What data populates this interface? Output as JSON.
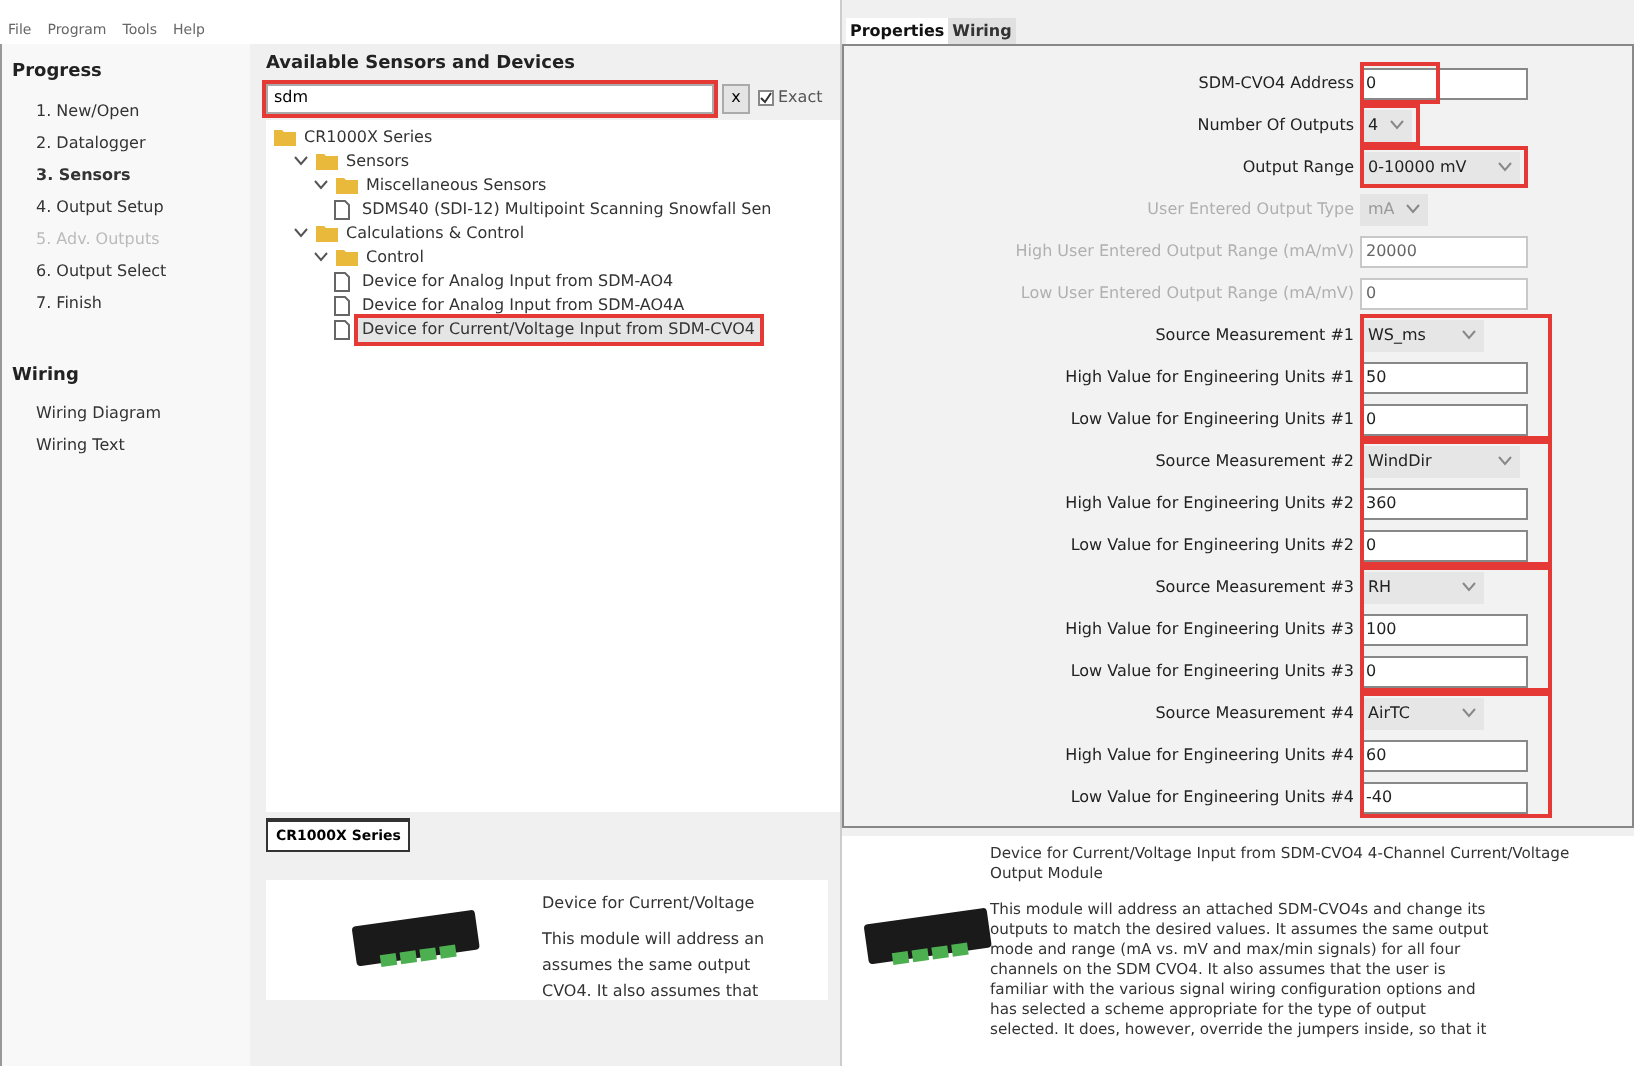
{
  "menu": [
    "File",
    "Program",
    "Tools",
    "Help"
  ],
  "sidebar": {
    "sections": [
      {
        "title": "Progress",
        "items": [
          {
            "label": "1. New/Open",
            "selected": false,
            "disabled": false
          },
          {
            "label": "2. Datalogger",
            "selected": false,
            "disabled": false
          },
          {
            "label": "3. Sensors",
            "selected": true,
            "disabled": false
          },
          {
            "label": "4. Output Setup",
            "selected": false,
            "disabled": false
          },
          {
            "label": "5. Adv. Outputs",
            "selected": false,
            "disabled": true
          },
          {
            "label": "6. Output Select",
            "selected": false,
            "disabled": false
          },
          {
            "label": "7. Finish",
            "selected": false,
            "disabled": false
          }
        ]
      },
      {
        "title": "Wiring",
        "items": [
          {
            "label": "Wiring Diagram",
            "selected": false,
            "disabled": false
          },
          {
            "label": "Wiring Text",
            "selected": false,
            "disabled": false
          }
        ]
      }
    ]
  },
  "sensors": {
    "title": "Available Sensors and Devices",
    "search": {
      "value": "sdm",
      "highlighted": true
    },
    "clear": "x",
    "exact": {
      "label": "Exact",
      "checked": true
    },
    "tree": [
      {
        "kind": "folder",
        "label": "CR1000X Series",
        "children": [
          {
            "kind": "folder",
            "label": "Sensors",
            "expanded": true,
            "children": [
              {
                "kind": "folder",
                "label": "Miscellaneous Sensors",
                "expanded": true,
                "children": [
                  {
                    "kind": "file",
                    "label": "SDMS40 (SDI-12) Multipoint Scanning Snowfall Sen",
                    "selected": false
                  }
                ]
              }
            ]
          },
          {
            "kind": "folder",
            "label": "Calculations & Control",
            "expanded": true,
            "children": [
              {
                "kind": "folder",
                "label": "Control",
                "expanded": true,
                "children": [
                  {
                    "kind": "file",
                    "label": "Device for Analog Input from SDM-AO4",
                    "selected": false
                  },
                  {
                    "kind": "file",
                    "label": "Device for Analog Input from SDM-AO4A",
                    "selected": false
                  },
                  {
                    "kind": "file",
                    "label": "Device for Current/Voltage Input from SDM-CVO4",
                    "selected": true
                  }
                ]
              }
            ]
          }
        ]
      }
    ],
    "tab": "CR1000X Series",
    "description": [
      "Device for Current/Voltage",
      "This module will address an",
      "assumes the same output",
      "CVO4. It also assumes that"
    ]
  },
  "tabs": [
    {
      "label": "Properties",
      "selected": true
    },
    {
      "label": "Wiring",
      "selected": false
    }
  ],
  "groups": [
    {
      "highlighted": true,
      "rows": [
        {
          "kind": "text",
          "label": "SDM-CVO4 Address",
          "value": "0",
          "disabled": false
        }
      ]
    },
    {
      "highlighted": true,
      "rows": [
        {
          "kind": "select",
          "label": "Number Of Outputs",
          "value": "4",
          "disabled": false
        }
      ]
    },
    {
      "highlighted": true,
      "rows": [
        {
          "kind": "select",
          "label": "Output Range",
          "value": "0-10000 mV",
          "disabled": false
        }
      ]
    },
    {
      "highlighted": false,
      "rows": [
        {
          "kind": "select",
          "label": "User Entered Output Type",
          "value": "mA",
          "disabled": true
        },
        {
          "kind": "text",
          "label": "High User Entered Output Range (mA/mV)",
          "value": "20000",
          "disabled": true
        },
        {
          "kind": "text",
          "label": "Low User Entered Output Range (mA/mV)",
          "value": "0",
          "disabled": true
        }
      ]
    },
    {
      "highlighted": true,
      "rows": [
        {
          "kind": "select",
          "label": "Source Measurement #1",
          "value": "WS_ms",
          "disabled": false
        },
        {
          "kind": "text",
          "label": "High Value for Engineering Units #1",
          "value": "50",
          "disabled": false
        },
        {
          "kind": "text",
          "label": "Low Value for Engineering Units #1",
          "value": "0",
          "disabled": false
        }
      ]
    },
    {
      "highlighted": true,
      "rows": [
        {
          "kind": "select",
          "label": "Source Measurement #2",
          "value": "WindDir",
          "disabled": false
        },
        {
          "kind": "text",
          "label": "High Value for Engineering Units #2",
          "value": "360",
          "disabled": false
        },
        {
          "kind": "text",
          "label": "Low Value for Engineering Units #2",
          "value": "0",
          "disabled": false
        }
      ]
    },
    {
      "highlighted": true,
      "rows": [
        {
          "kind": "select",
          "label": "Source Measurement #3",
          "value": "RH",
          "disabled": false
        },
        {
          "kind": "text",
          "label": "High Value for Engineering Units #3",
          "value": "100",
          "disabled": false
        },
        {
          "kind": "text",
          "label": "Low Value for Engineering Units #3",
          "value": "0",
          "disabled": false
        }
      ]
    },
    {
      "highlighted": true,
      "rows": [
        {
          "kind": "select",
          "label": "Source Measurement #4",
          "value": "AirTC",
          "disabled": false
        },
        {
          "kind": "text",
          "label": "High Value for Engineering Units #4",
          "value": "60",
          "disabled": false
        },
        {
          "kind": "text",
          "label": "Low Value for Engineering Units #4",
          "value": "-40",
          "disabled": false
        }
      ]
    }
  ],
  "info": {
    "title": "Device for Current/Voltage Input from SDM-CVO4 4-Channel Current/Voltage Output Module",
    "body": [
      "This module will address an attached SDM-CVO4s and change its",
      "outputs to match the desired values. It assumes the same output",
      "mode and range (mA vs. mV and max/min signals) for all four",
      "channels on the SDM CVO4. It also assumes that the user is",
      "familiar with the various signal wiring configuration options and",
      "has selected a scheme appropriate for the type of output",
      "selected. It does, however, override the jumpers inside, so that it"
    ]
  }
}
